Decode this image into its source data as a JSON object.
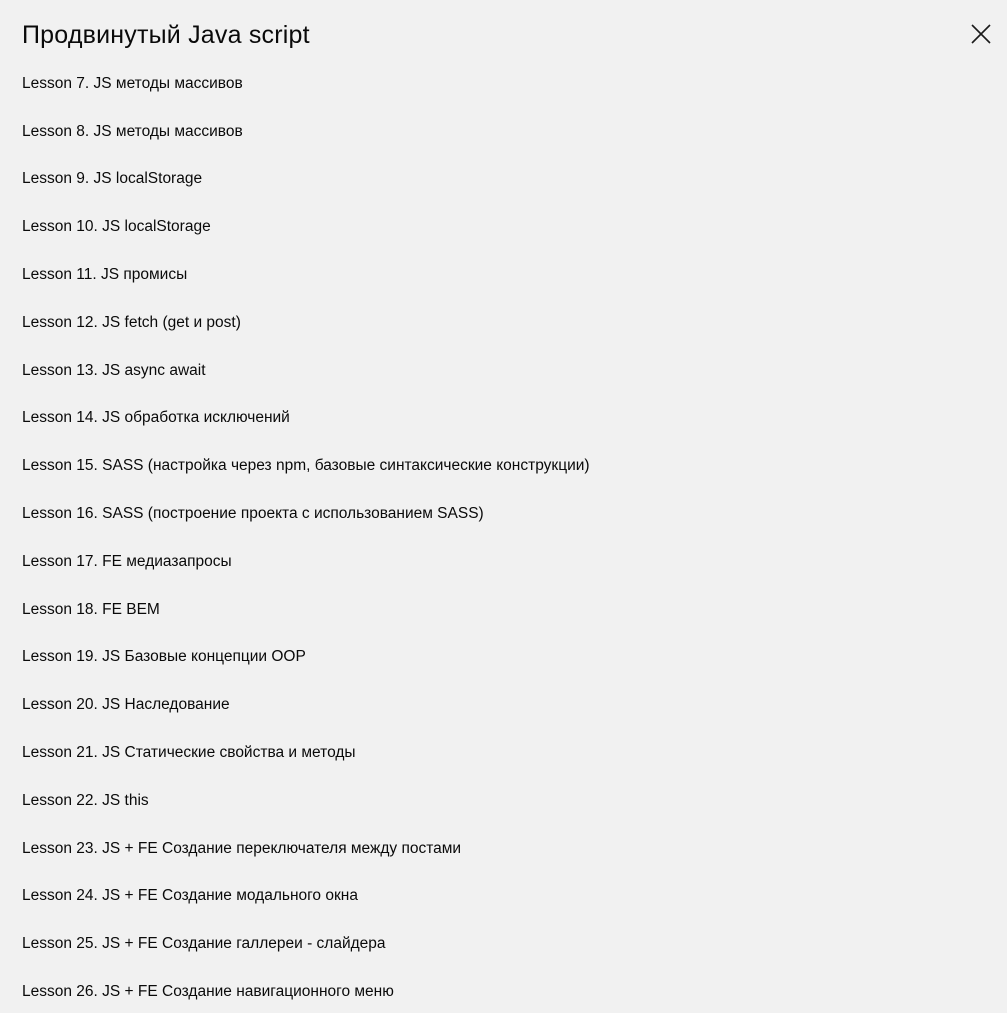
{
  "modal": {
    "title": "Продвинутый Java script",
    "close_icon": "close-icon"
  },
  "lessons": [
    {
      "label": "Lesson 7. JS методы массивов"
    },
    {
      "label": "Lesson 8. JS методы массивов"
    },
    {
      "label": "Lesson 9. JS localStorage"
    },
    {
      "label": "Lesson 10. JS localStorage"
    },
    {
      "label": "Lesson 11. JS промисы"
    },
    {
      "label": "Lesson 12. JS fetch (get и post)"
    },
    {
      "label": "Lesson 13. JS async await"
    },
    {
      "label": "Lesson 14. JS обработка исключений"
    },
    {
      "label": "Lesson 15. SASS (настройка через npm, базовые синтаксические конструкции)"
    },
    {
      "label": "Lesson 16. SASS (построение проекта с использованием SASS)"
    },
    {
      "label": "Lesson 17. FE медиазапросы"
    },
    {
      "label": "Lesson 18. FE BEM"
    },
    {
      "label": "Lesson 19. JS Базовые концепции ООР"
    },
    {
      "label": "Lesson 20. JS Наследование"
    },
    {
      "label": "Lesson 21. JS Статические свойства и методы"
    },
    {
      "label": "Lesson 22. JS this"
    },
    {
      "label": "Lesson 23. JS + FE Создание переключателя между постами"
    },
    {
      "label": "Lesson 24. JS + FE Создание модального окна"
    },
    {
      "label": "Lesson 25. JS + FE Создание галлереи - слайдера"
    },
    {
      "label": "Lesson 26. JS + FE Создание навигационного меню"
    }
  ]
}
